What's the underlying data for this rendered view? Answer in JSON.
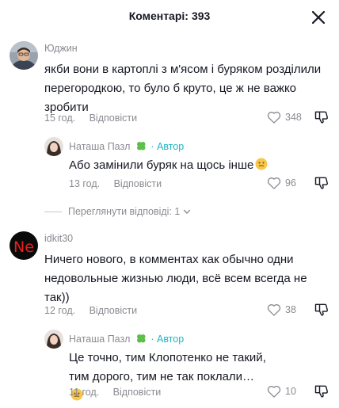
{
  "header": {
    "title": "Коментарі:",
    "count": "393"
  },
  "comments": [
    {
      "username": "Юджин",
      "text": "якби вони в картоплі з м'ясом і буряком розділили перегородкою, то було б круто, це ж не важко зробити",
      "time": "15 год.",
      "reply_label": "Відповісти",
      "likes": "348"
    },
    {
      "username": "Наташа Пазл",
      "author_tag": "· Автор",
      "text": "Або замінили буряк на щось інше",
      "time": "13 год.",
      "reply_label": "Відповісти",
      "likes": "96"
    },
    {
      "username": "idkit30",
      "text": "Ничего нового, в комментах как обычно одни недовольные жизнью люди, всё всем всегда не так))",
      "time": "12 год.",
      "reply_label": "Відповісти",
      "likes": "38"
    },
    {
      "username": "Наташа Пазл",
      "author_tag": "· Автор",
      "text": "Це точно, тим Клопотенко не такий, тим дорого, тим не так поклали…",
      "time": "11 год.",
      "reply_label": "Відповісти",
      "likes": "10"
    }
  ],
  "view_replies": {
    "label": "Переглянути відповіді: 1"
  },
  "avatar_text": {
    "idkit30": "Ne"
  },
  "colors": {
    "text": "#161823",
    "secondary": "#8a8b91",
    "author_accent": "#1db6c5"
  },
  "icons": [
    "close-icon",
    "heart-icon",
    "dislike-icon",
    "clover-icon",
    "chevron-down-icon",
    "emoji-icon"
  ]
}
